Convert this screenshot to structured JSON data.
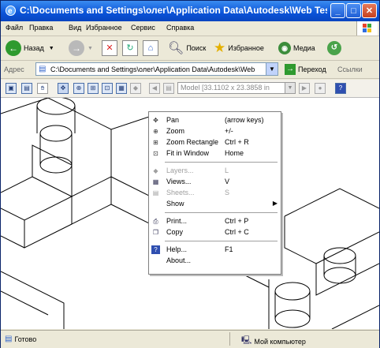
{
  "window": {
    "title": "C:\\Documents and Settings\\олег\\Application Data\\Autodesk\\Web Test P...",
    "minimize": "_",
    "maximize": "□",
    "close": "✕"
  },
  "menu": [
    "Файл",
    "Правка",
    "Вид",
    "Избранное",
    "Сервис",
    "Справка"
  ],
  "toolbar": {
    "back_label": "Назад",
    "search_label": "Поиск",
    "favorites_label": "Избранное",
    "media_label": "Медиа"
  },
  "address": {
    "label": "Адрес",
    "value": "C:\\Documents and Settings\\олег\\Application Data\\Autodesk\\Web",
    "go_label": "Переход",
    "links_label": "Ссылки"
  },
  "viewer": {
    "model_select": "Model [33.1102 x 23.3858 in"
  },
  "context_menu": [
    {
      "label": "Pan",
      "shortcut": "(arrow keys)",
      "icon": "pan-icon",
      "disabled": false
    },
    {
      "label": "Zoom",
      "shortcut": "+/-",
      "icon": "zoom-icon",
      "disabled": false
    },
    {
      "label": "Zoom Rectangle",
      "shortcut": "Ctrl + R",
      "icon": "zoom-rectangle-icon",
      "disabled": false
    },
    {
      "label": "Fit in Window",
      "shortcut": "Home",
      "icon": "fit-window-icon",
      "disabled": false
    },
    {
      "label": "Layers...",
      "shortcut": "L",
      "icon": "layers-icon",
      "disabled": true
    },
    {
      "label": "Views...",
      "shortcut": "V",
      "icon": "views-icon",
      "disabled": false
    },
    {
      "label": "Sheets...",
      "shortcut": "S",
      "icon": "sheets-icon",
      "disabled": true
    },
    {
      "label": "Show",
      "shortcut": "",
      "icon": "",
      "disabled": false,
      "submenu": true
    },
    {
      "label": "Print...",
      "shortcut": "Ctrl + P",
      "icon": "print-icon",
      "disabled": false
    },
    {
      "label": "Copy",
      "shortcut": "Ctrl + C",
      "icon": "copy-icon",
      "disabled": false
    },
    {
      "label": "Help...",
      "shortcut": "F1",
      "icon": "help-icon",
      "disabled": false
    },
    {
      "label": "About...",
      "shortcut": "",
      "icon": "",
      "disabled": false
    }
  ],
  "status": {
    "left": "Готово",
    "zone": "Мой компьютер"
  }
}
